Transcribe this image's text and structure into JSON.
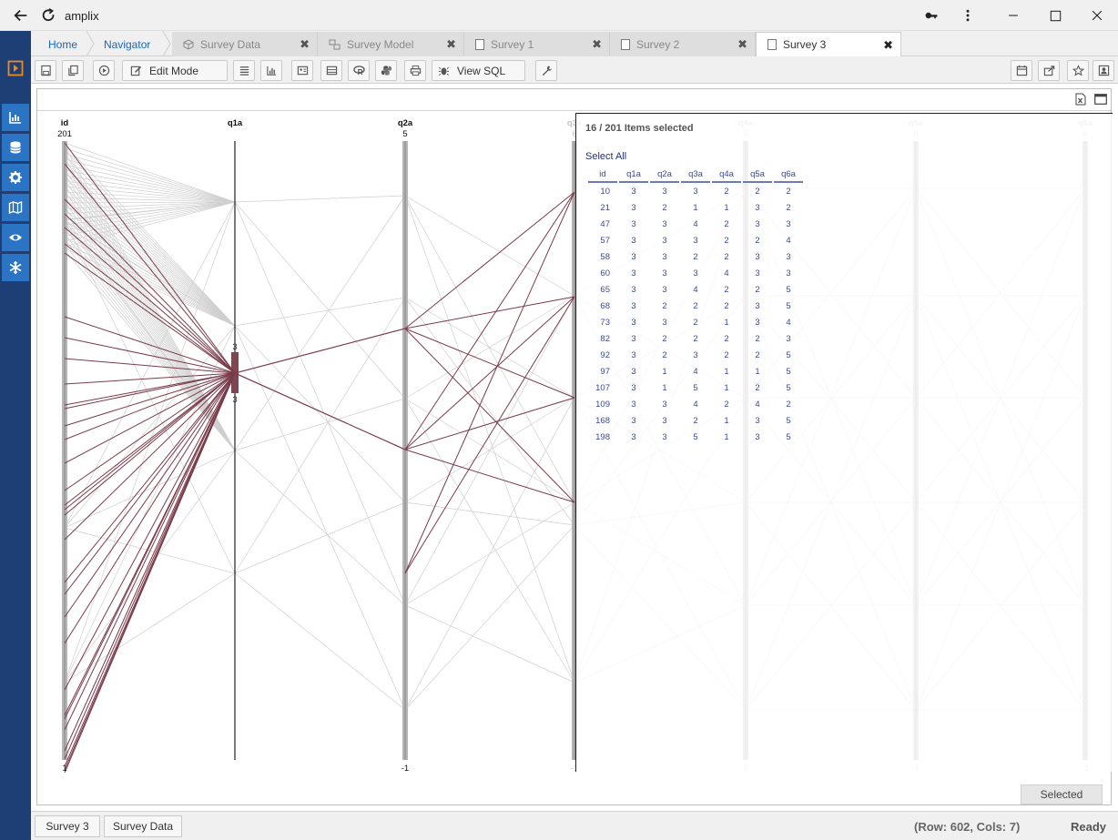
{
  "window": {
    "title": "amplix"
  },
  "tabs": [
    {
      "label": "Home",
      "kind": "crumb"
    },
    {
      "label": "Navigator",
      "kind": "crumb"
    },
    {
      "label": "Survey Data",
      "kind": "inactive",
      "icon": "cube-icon"
    },
    {
      "label": "Survey Model",
      "kind": "inactive",
      "icon": "model-icon"
    },
    {
      "label": "Survey 1",
      "kind": "inactive",
      "icon": "document-icon"
    },
    {
      "label": "Survey 2",
      "kind": "inactive",
      "icon": "document-icon"
    },
    {
      "label": "Survey 3",
      "kind": "active",
      "icon": "document-icon"
    }
  ],
  "toolbar": {
    "edit_mode_label": "Edit Mode",
    "view_sql_label": "View SQL"
  },
  "selection": {
    "count_text": "16 / 201 Items selected",
    "select_all_label": "Select All",
    "columns": [
      "id",
      "q1a",
      "q2a",
      "q3a",
      "q4a",
      "q5a",
      "q6a"
    ],
    "rows": [
      [
        "10",
        "3",
        "3",
        "3",
        "2",
        "2",
        "2"
      ],
      [
        "21",
        "3",
        "2",
        "1",
        "1",
        "3",
        "2"
      ],
      [
        "47",
        "3",
        "3",
        "4",
        "2",
        "3",
        "3"
      ],
      [
        "57",
        "3",
        "3",
        "3",
        "2",
        "2",
        "4"
      ],
      [
        "58",
        "3",
        "3",
        "2",
        "2",
        "3",
        "3"
      ],
      [
        "60",
        "3",
        "3",
        "3",
        "4",
        "3",
        "3"
      ],
      [
        "65",
        "3",
        "3",
        "4",
        "2",
        "2",
        "5"
      ],
      [
        "68",
        "3",
        "2",
        "2",
        "2",
        "3",
        "5"
      ],
      [
        "73",
        "3",
        "3",
        "2",
        "1",
        "3",
        "4"
      ],
      [
        "82",
        "3",
        "2",
        "2",
        "2",
        "2",
        "3"
      ],
      [
        "92",
        "3",
        "2",
        "3",
        "2",
        "2",
        "5"
      ],
      [
        "97",
        "3",
        "1",
        "4",
        "1",
        "1",
        "5"
      ],
      [
        "107",
        "3",
        "1",
        "5",
        "1",
        "2",
        "5"
      ],
      [
        "109",
        "3",
        "3",
        "4",
        "2",
        "4",
        "2"
      ],
      [
        "168",
        "3",
        "3",
        "2",
        "1",
        "3",
        "5"
      ],
      [
        "198",
        "3",
        "3",
        "5",
        "1",
        "3",
        "5"
      ]
    ]
  },
  "selected_button_label": "Selected",
  "status": {
    "bottom_tabs": [
      "Survey 3",
      "Survey Data"
    ],
    "row_cols": "(Row: 602, Cols: 7)",
    "state": "Ready"
  },
  "chart_data": {
    "type": "parallel-coordinates",
    "axes": [
      {
        "name": "id",
        "max": 201,
        "min": 1
      },
      {
        "name": "q1a",
        "min": null,
        "max": null,
        "brush_label_top": "3",
        "brush_label_bottom": "3"
      },
      {
        "name": "q2a",
        "max": 5,
        "min": -1
      },
      {
        "name": "q3a",
        "max": 6,
        "min": -1
      },
      {
        "name": "q4a",
        "max": 5,
        "min": 1
      },
      {
        "name": "q5a",
        "max": 6,
        "min": -1
      },
      {
        "name": "q6a",
        "max": 6,
        "min": -1
      }
    ],
    "q1a_brush": [
      3,
      3
    ],
    "colors": {
      "selected": "#7a3b4a",
      "background": "#cfcfcf",
      "brush": "#7d4650",
      "axis": "#999999"
    }
  }
}
